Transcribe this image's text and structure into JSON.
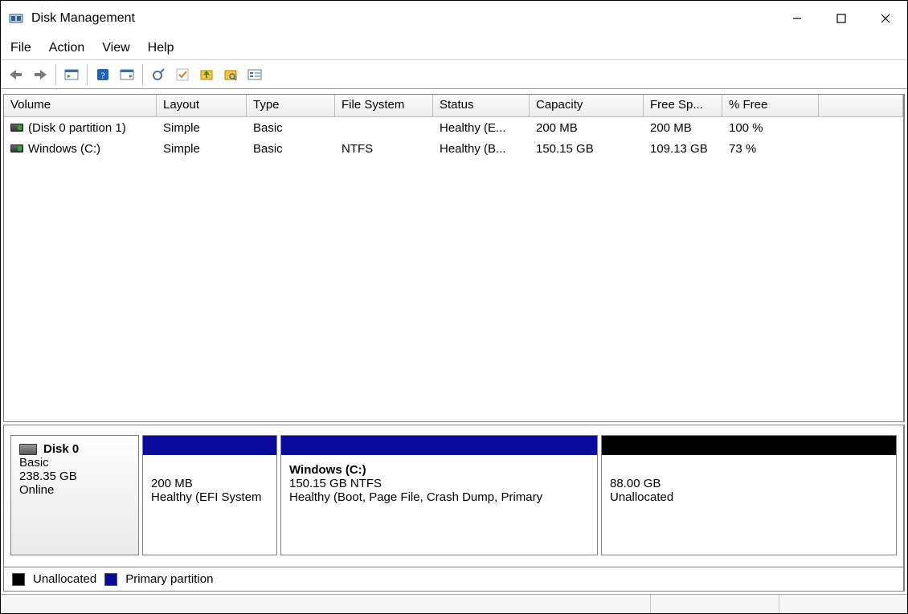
{
  "titlebar": {
    "title": "Disk Management"
  },
  "menu": {
    "items": [
      "File",
      "Action",
      "View",
      "Help"
    ]
  },
  "toolbar": {
    "buttons": [
      "back",
      "forward",
      "show-hide-tree",
      "help",
      "properties",
      "refresh",
      "paste",
      "undo",
      "new",
      "settings"
    ]
  },
  "volumes": {
    "columns": {
      "volume": "Volume",
      "layout": "Layout",
      "type": "Type",
      "filesystem": "File System",
      "status": "Status",
      "capacity": "Capacity",
      "free": "Free Sp...",
      "pct": "% Free"
    },
    "rows": [
      {
        "volume": "(Disk 0 partition 1)",
        "layout": "Simple",
        "type": "Basic",
        "filesystem": "",
        "status": "Healthy (E...",
        "capacity": "200 MB",
        "free": "200 MB",
        "pct": "100 %"
      },
      {
        "volume": "Windows (C:)",
        "layout": "Simple",
        "type": "Basic",
        "filesystem": "NTFS",
        "status": "Healthy (B...",
        "capacity": "150.15 GB",
        "free": "109.13 GB",
        "pct": "73 %"
      }
    ]
  },
  "disk": {
    "name": "Disk 0",
    "type": "Basic",
    "capacity": "238.35 GB",
    "state": "Online",
    "partitions": [
      {
        "title": "",
        "line1": "200 MB",
        "line2": "Healthy (EFI System",
        "band": "blue",
        "widthPx": 168
      },
      {
        "title": "Windows  (C:)",
        "line1": "150.15 GB NTFS",
        "line2": "Healthy (Boot, Page File, Crash Dump, Primary",
        "band": "blue",
        "widthPx": 395
      },
      {
        "title": "",
        "line1": "88.00 GB",
        "line2": "Unallocated",
        "band": "black",
        "widthPx": 373
      }
    ]
  },
  "legend": {
    "unallocated": "Unallocated",
    "primary": "Primary partition"
  }
}
